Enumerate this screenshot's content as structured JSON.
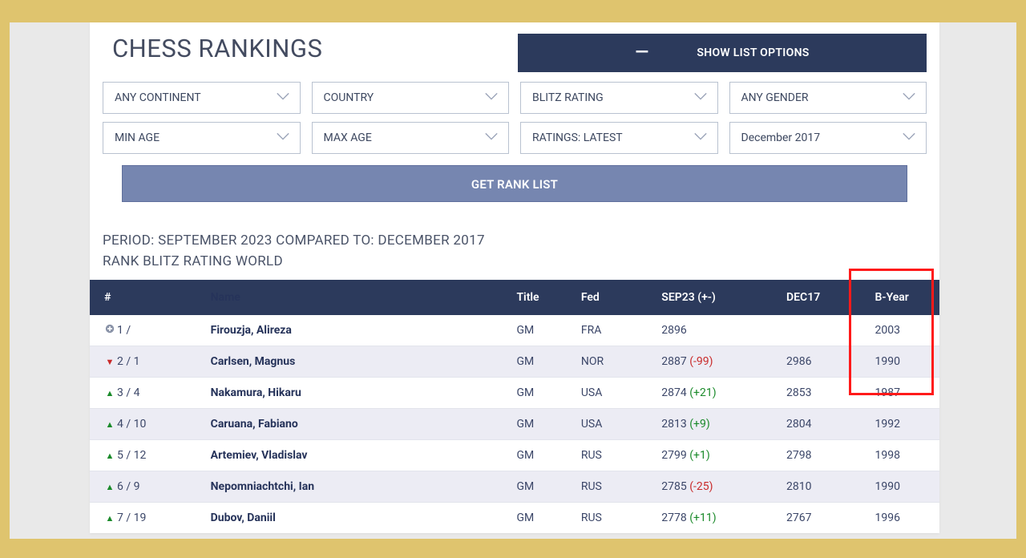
{
  "title": "CHESS RANKINGS",
  "options_label": "SHOW LIST OPTIONS",
  "filters": {
    "continent": "ANY CONTINENT",
    "country": "COUNTRY",
    "rating_type": "BLITZ RATING",
    "gender": "ANY GENDER",
    "min_age": "MIN AGE",
    "max_age": "MAX AGE",
    "ratings": "RATINGS: LATEST",
    "compare_month": "December 2017"
  },
  "get_rank_label": "GET RANK LIST",
  "period_line1": "PERIOD: SEPTEMBER 2023 COMPARED TO: DECEMBER 2017",
  "period_line2": "RANK BLITZ RATING WORLD",
  "columns": {
    "rank": "#",
    "name": "Name",
    "title": "Title",
    "fed": "Fed",
    "sep": "SEP23 (+-)",
    "dec": "DEC17",
    "byear": "B-Year"
  },
  "rows": [
    {
      "icon": "plus",
      "rank": "1 /",
      "name": "Firouzja, Alireza",
      "title": "GM",
      "fed": "FRA",
      "sep": "2896",
      "delta": "",
      "delta_sign": "",
      "dec": "",
      "byear": "2003"
    },
    {
      "icon": "down",
      "rank": "2 / 1",
      "name": "Carlsen, Magnus",
      "title": "GM",
      "fed": "NOR",
      "sep": "2887",
      "delta": "(-99)",
      "delta_sign": "neg",
      "dec": "2986",
      "byear": "1990"
    },
    {
      "icon": "up",
      "rank": "3 / 4",
      "name": "Nakamura, Hikaru",
      "title": "GM",
      "fed": "USA",
      "sep": "2874",
      "delta": "(+21)",
      "delta_sign": "pos",
      "dec": "2853",
      "byear": "1987"
    },
    {
      "icon": "up",
      "rank": "4 / 10",
      "name": "Caruana, Fabiano",
      "title": "GM",
      "fed": "USA",
      "sep": "2813",
      "delta": "(+9)",
      "delta_sign": "pos",
      "dec": "2804",
      "byear": "1992"
    },
    {
      "icon": "up",
      "rank": "5 / 12",
      "name": "Artemiev, Vladislav",
      "title": "GM",
      "fed": "RUS",
      "sep": "2799",
      "delta": "(+1)",
      "delta_sign": "pos",
      "dec": "2798",
      "byear": "1998"
    },
    {
      "icon": "up",
      "rank": "6 / 9",
      "name": "Nepomniachtchi, Ian",
      "title": "GM",
      "fed": "RUS",
      "sep": "2785",
      "delta": "(-25)",
      "delta_sign": "neg",
      "dec": "2810",
      "byear": "1990"
    },
    {
      "icon": "up",
      "rank": "7 / 19",
      "name": "Dubov, Daniil",
      "title": "GM",
      "fed": "RUS",
      "sep": "2778",
      "delta": "(+11)",
      "delta_sign": "pos",
      "dec": "2767",
      "byear": "1996"
    }
  ]
}
